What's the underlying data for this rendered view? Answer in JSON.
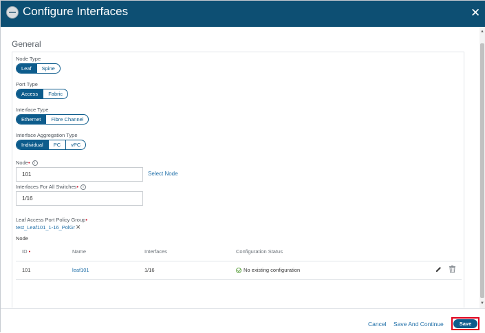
{
  "dialog": {
    "title": "Configure Interfaces"
  },
  "general": {
    "section_label": "General",
    "node_type": {
      "label": "Node Type",
      "options": [
        "Leaf",
        "Spine"
      ],
      "selected": "Leaf"
    },
    "port_type": {
      "label": "Port Type",
      "options": [
        "Access",
        "Fabric"
      ],
      "selected": "Access"
    },
    "interface_type": {
      "label": "Interface Type",
      "options": [
        "Ethernet",
        "Fibre Channel"
      ],
      "selected": "Ethernet"
    },
    "aggregation_type": {
      "label": "Interface Aggregation Type",
      "options": [
        "Individual",
        "PC",
        "vPC"
      ],
      "selected": "Individual"
    },
    "node": {
      "label": "Node",
      "value": "101",
      "select_link": "Select Node"
    },
    "interfaces_all": {
      "label": "Interfaces For All Switches",
      "value": "1/16"
    },
    "policy_group": {
      "label": "Leaf Access Port Policy Group",
      "value": "test_Leaf101_1-16_PolGr"
    },
    "node_table": {
      "label": "Node",
      "columns": [
        "ID",
        "Name",
        "Interfaces",
        "Configuration Status"
      ],
      "rows": [
        {
          "id": "101",
          "name": "leaf101",
          "interfaces": "1/16",
          "status": "No existing configuration"
        }
      ]
    }
  },
  "footer": {
    "cancel": "Cancel",
    "save_continue": "Save And Continue",
    "save": "Save"
  },
  "colors": {
    "header_bg": "#0d4f73",
    "accent": "#0d5c8c",
    "link": "#1f6fa8",
    "required": "#d0021b",
    "highlight_border": "#e0001b",
    "success": "#6aa84f"
  }
}
